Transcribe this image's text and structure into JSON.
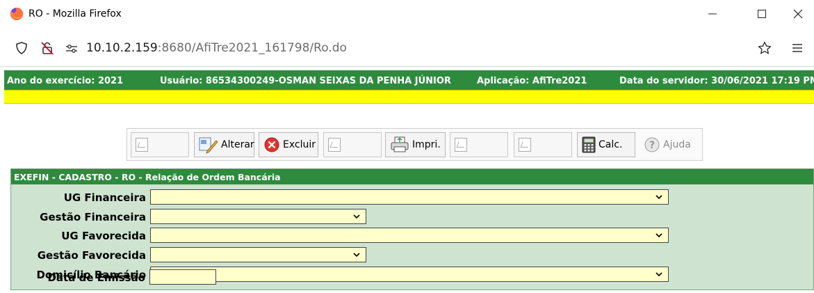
{
  "window": {
    "title": "RO - Mozilla Firefox"
  },
  "navbar": {
    "url_host": "10.10.2.159",
    "url_rest": ":8680/AfiTre2021_161798/Ro.do"
  },
  "infobar": {
    "year": "Ano do exercício: 2021",
    "user": "Usuário: 86534300249-OSMAN SEIXAS DA PENHA JÚNIOR",
    "app": "Aplicação: AfiTre2021",
    "server_date": "Data do servidor: 30/06/2021 17:19 PM"
  },
  "toolbar": {
    "alterar": "Alterar",
    "excluir": "Excluir",
    "imprimir": "Impri.",
    "calc": "Calc.",
    "ajuda": "Ajuda"
  },
  "panel": {
    "title": "EXEFIN - CADASTRO - RO - Relação de Ordem Bancária",
    "fields": {
      "ug_financeira": {
        "label": "UG Financeira",
        "value": ""
      },
      "gestao_financeira": {
        "label": "Gestão Financeira",
        "value": ""
      },
      "ug_favorecida": {
        "label": "UG Favorecida",
        "value": ""
      },
      "gestao_favorecida": {
        "label": "Gestão Favorecida",
        "value": ""
      },
      "domicilio_bancario": {
        "label": "Domicílio Bancário",
        "value": ""
      },
      "data_emissao": {
        "label": "Data de Emissão",
        "value": ""
      }
    }
  },
  "colors": {
    "green_bar": "#2e8b3e",
    "yellow_bar": "#ffff00",
    "panel_bg": "#cfe3d1",
    "field_bg": "#ffffcc"
  }
}
